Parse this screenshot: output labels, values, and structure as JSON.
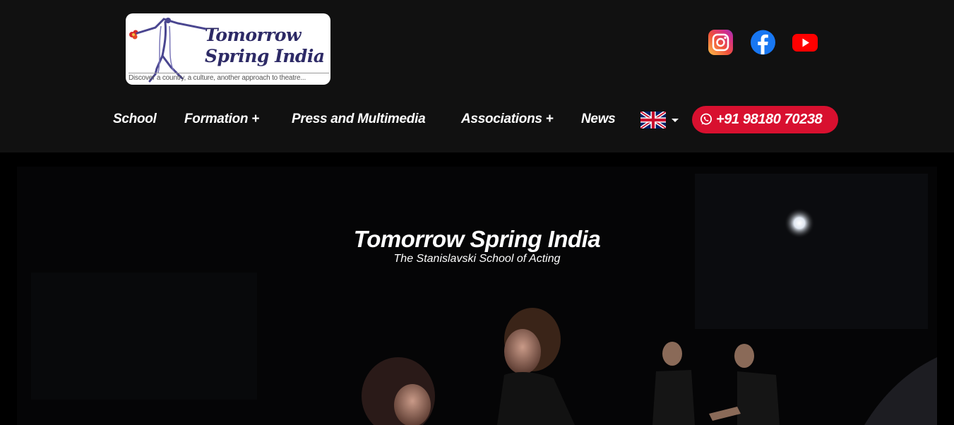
{
  "logo": {
    "title_line1": "Tomorrow",
    "title_line2": "Spring India",
    "tagline": "Discover a country, a culture, another approach to theatre..."
  },
  "social": {
    "instagram_icon": "instagram-icon",
    "facebook_icon": "facebook-icon",
    "youtube_icon": "youtube-icon"
  },
  "nav": {
    "items": [
      {
        "label": "School"
      },
      {
        "label": "Formation +"
      },
      {
        "label": "Press and Multimedia"
      },
      {
        "label": "Associations +"
      },
      {
        "label": "News"
      }
    ],
    "language_icon": "uk-flag-icon",
    "phone": "+91 98180 70238"
  },
  "hero": {
    "title": "Tomorrow Spring India",
    "subtitle": "The Stanislavski School of Acting"
  },
  "colors": {
    "header_bg": "#111111",
    "phone_button": "#d8102f",
    "logo_text": "#2d2a66"
  }
}
